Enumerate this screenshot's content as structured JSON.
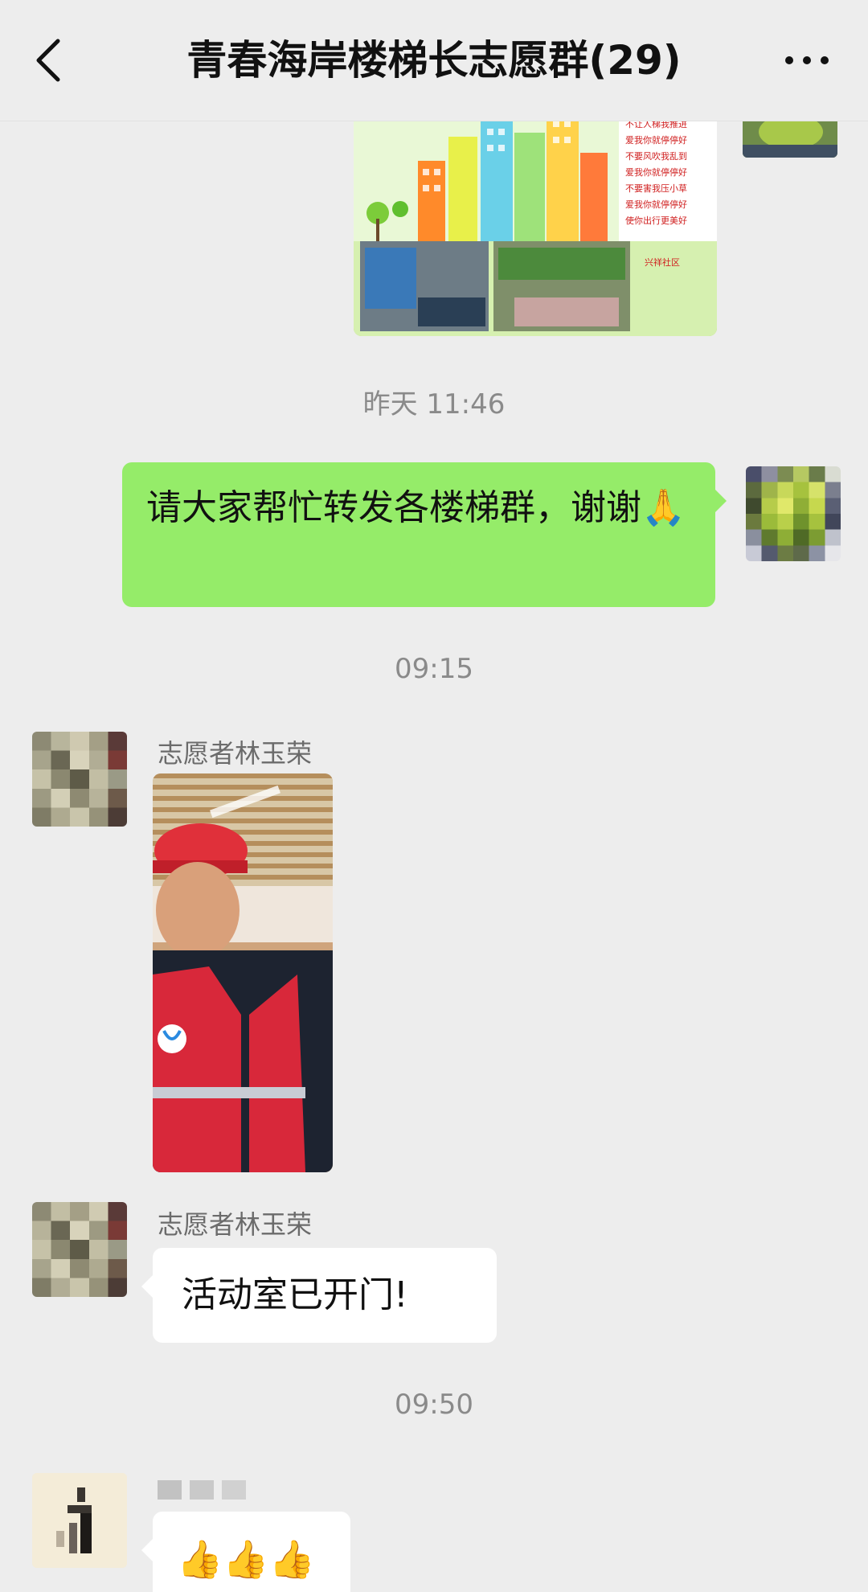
{
  "header": {
    "title": "青春海岸楼梯长志愿群(29)"
  },
  "messages": {
    "time_1": "昨天 11:46",
    "outgoing_text": "请大家帮忙转发各楼梯群，谢谢🙏",
    "time_2": "09:15",
    "sender_1": "志愿者林玉荣",
    "sender_2": "志愿者林玉荣",
    "incoming_text": "活动室已开门!",
    "time_3": "09:50",
    "last_text": "👍👍👍"
  },
  "poster": {
    "lines": [
      "不让人梯我推进",
      "爱我你就停停好",
      "不要风吹我乱到",
      "爱我你就停停好",
      "不要害我压小草",
      "爱我你就停停好",
      "使你出行更美好"
    ],
    "community": "兴祥社区"
  },
  "colors": {
    "outgoing_bubble": "#95ec69",
    "incoming_bubble": "#ffffff",
    "background": "#ededed",
    "timestamp": "#8a8a8a"
  },
  "icons": {
    "back": "chevron-left-icon",
    "more": "more-dots-icon"
  }
}
